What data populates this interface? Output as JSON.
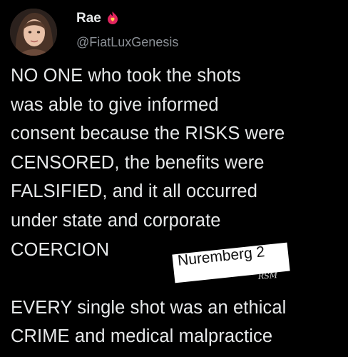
{
  "author": {
    "display_name": "Rae",
    "handle": "@FiatLuxGenesis",
    "name_emoji_icon": "flame-heart-icon",
    "avatar_icon": "profile-photo"
  },
  "tweet": {
    "lines": [
      "NO ONE who took the shots",
      "was able to give informed",
      "consent because the RISKS were",
      "CENSORED, the benefits were",
      "FALSIFIED, and it all occurred",
      "under state and corporate",
      "COERCION",
      "EVERY single shot was an ethical",
      "CRIME and medical malpractice"
    ]
  },
  "overlay": {
    "sticker_text": "Nuremberg 2",
    "signature": "RSM"
  },
  "colors": {
    "background": "#000000",
    "primary_text": "#e7e9ea",
    "secondary_text": "#8b9096",
    "sticker_bg": "#ffffff",
    "flame": "#e0245e"
  }
}
